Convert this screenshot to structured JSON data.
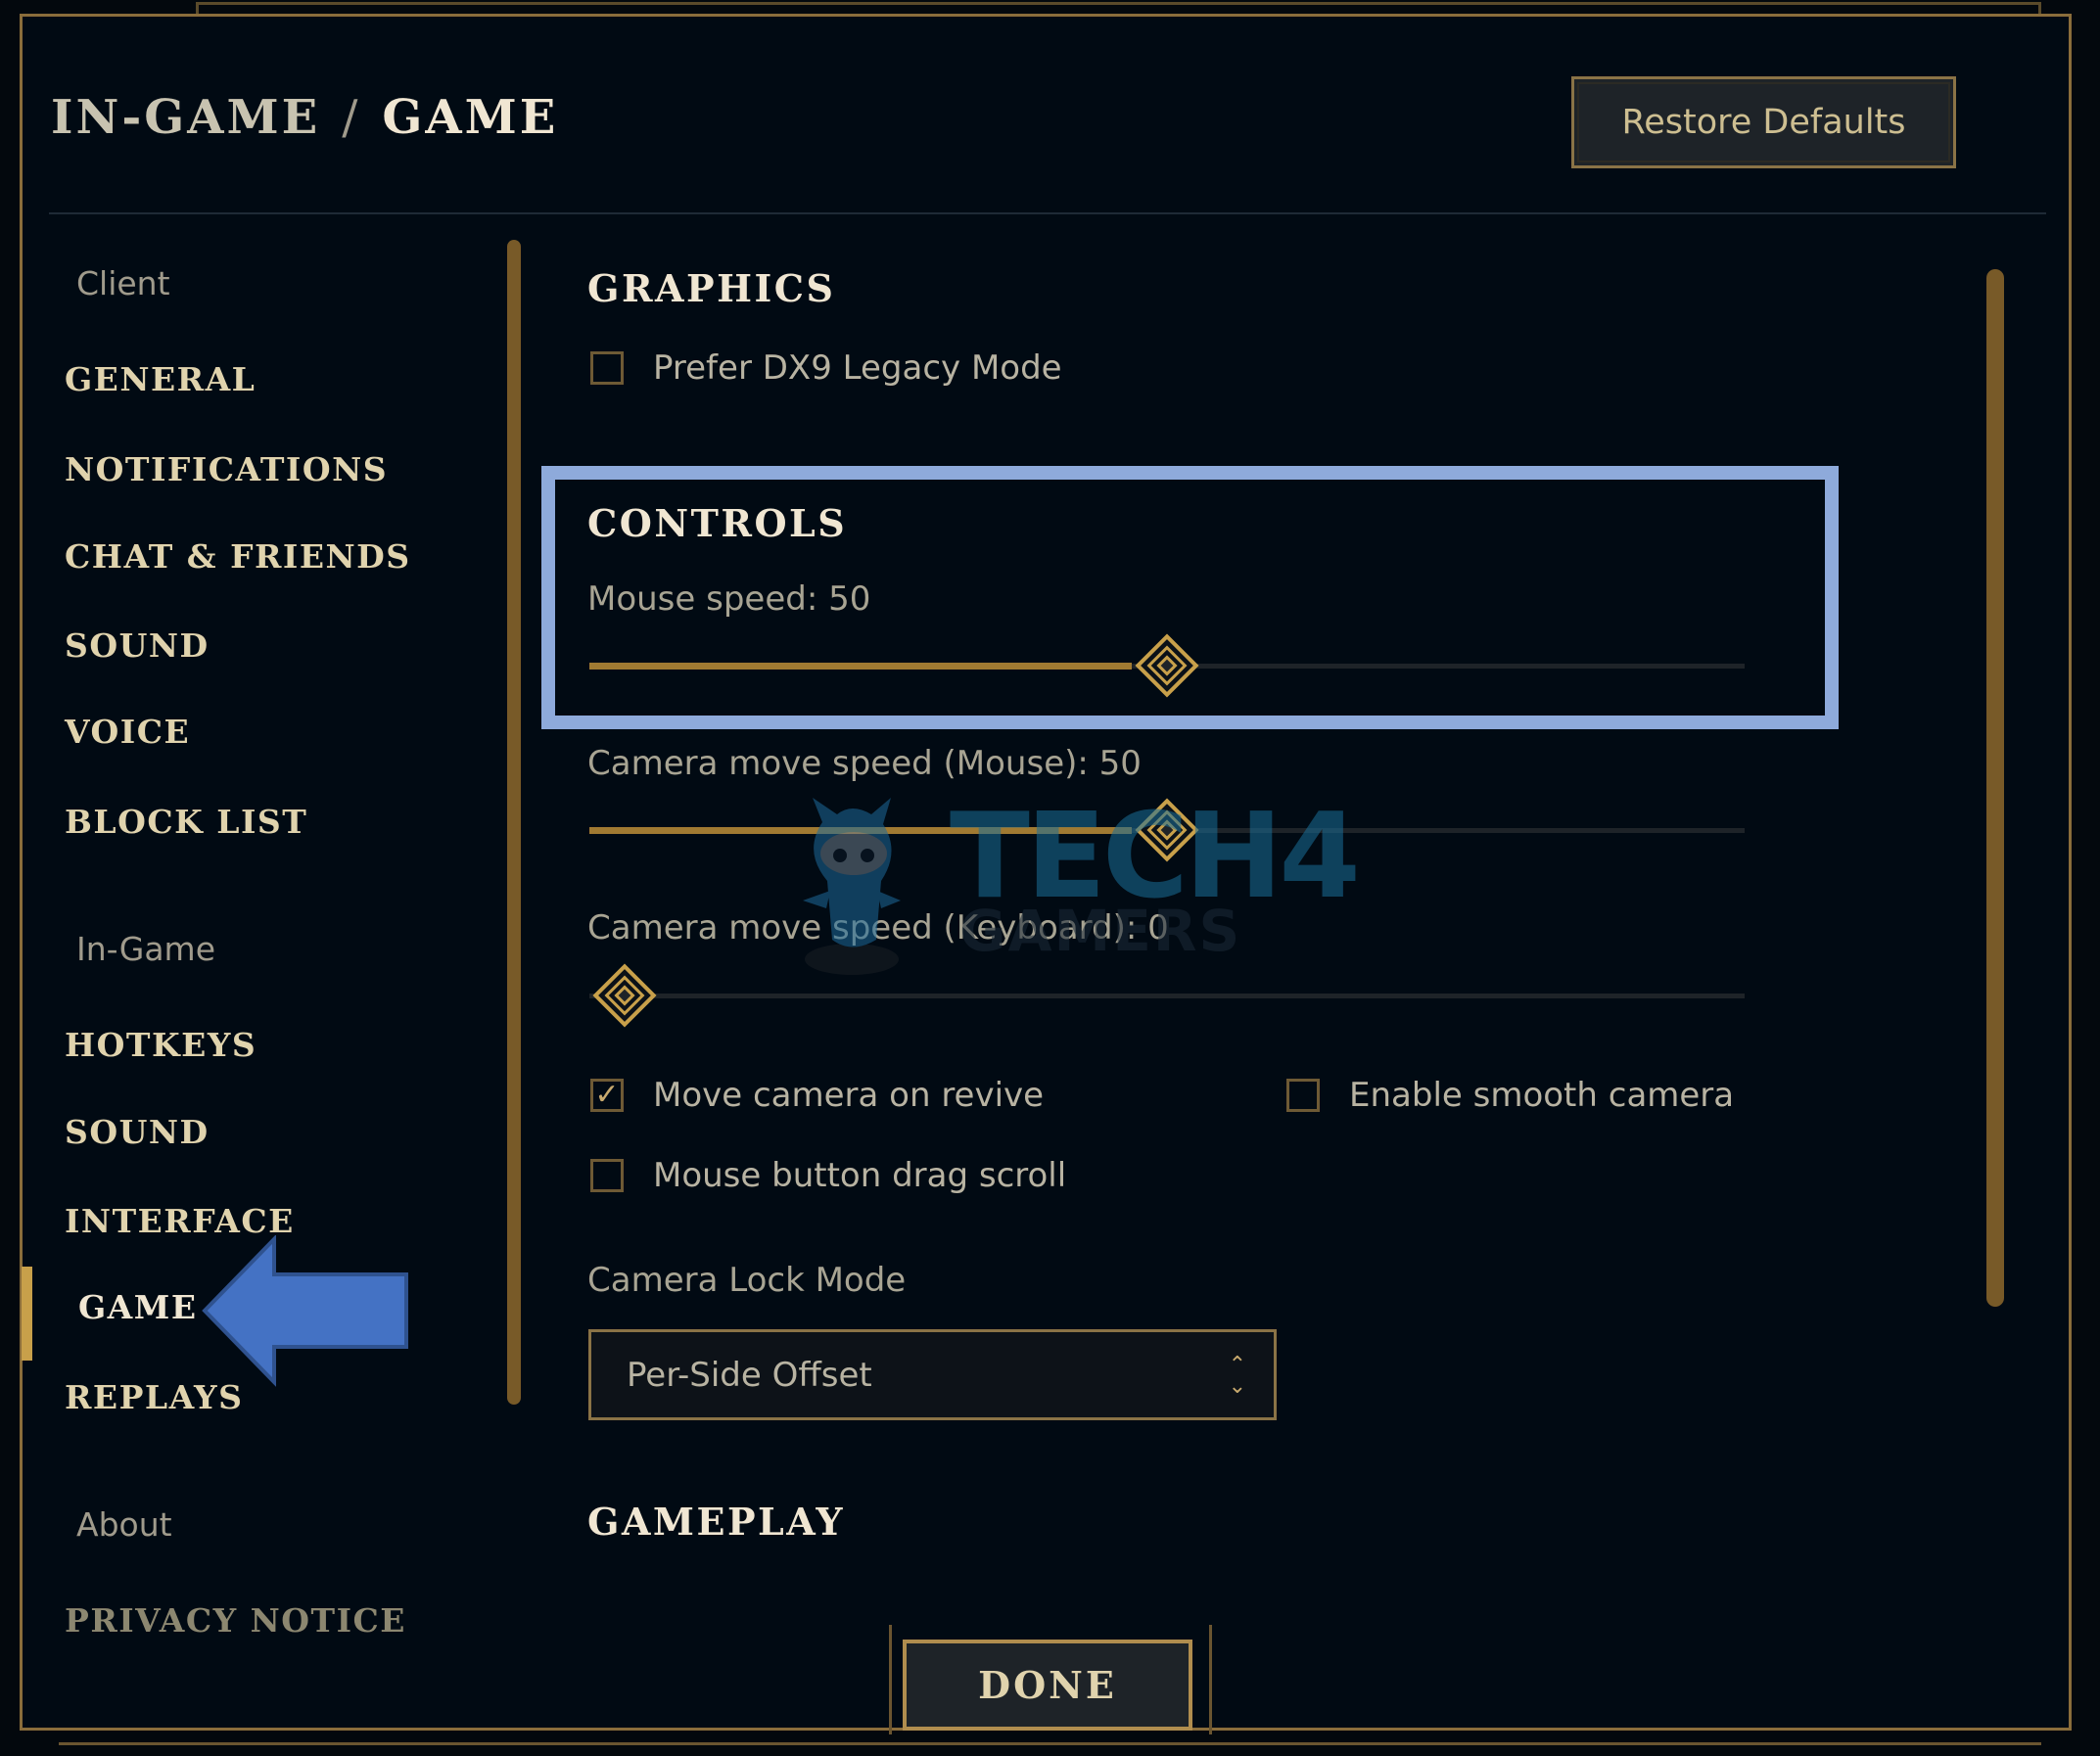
{
  "header": {
    "breadcrumb_parent": "IN-GAME",
    "breadcrumb_separator": "/",
    "breadcrumb_current": "GAME",
    "restore_defaults_label": "Restore Defaults"
  },
  "sidebar": {
    "groups": [
      {
        "label": "Client",
        "items": [
          "GENERAL",
          "NOTIFICATIONS",
          "CHAT & FRIENDS",
          "SOUND",
          "VOICE",
          "BLOCK LIST"
        ]
      },
      {
        "label": "In-Game",
        "items": [
          "HOTKEYS",
          "SOUND",
          "INTERFACE",
          "GAME",
          "REPLAYS"
        ]
      },
      {
        "label": "About",
        "items": [
          "PRIVACY NOTICE"
        ]
      }
    ],
    "active_item": "GAME"
  },
  "content": {
    "graphics": {
      "title": "GRAPHICS",
      "prefer_dx9": {
        "label": "Prefer DX9 Legacy Mode",
        "checked": false
      }
    },
    "controls": {
      "title": "CONTROLS",
      "mouse_speed": {
        "label": "Mouse speed: 50",
        "value": 50,
        "max": 100
      },
      "camera_mouse": {
        "label": "Camera move speed (Mouse): 50",
        "value": 50,
        "max": 100
      },
      "camera_keyboard": {
        "label": "Camera move speed (Keyboard): 0",
        "value": 0,
        "max": 100
      },
      "move_camera_revive": {
        "label": "Move camera on revive",
        "checked": true
      },
      "smooth_camera": {
        "label": "Enable smooth camera",
        "checked": false
      },
      "drag_scroll": {
        "label": "Mouse button drag scroll",
        "checked": false
      },
      "camera_lock_mode": {
        "label": "Camera Lock Mode",
        "selected": "Per-Side Offset"
      }
    },
    "gameplay": {
      "title": "GAMEPLAY"
    }
  },
  "footer": {
    "done_label": "DONE"
  },
  "annotations": {
    "highlight_color": "#8eaadb",
    "arrow_color": "#4472c4"
  },
  "watermark": {
    "line1": "TECH4",
    "line2": "GAMERS"
  },
  "colors": {
    "gold": "#c8aa6e",
    "gold_dark": "#785a28",
    "background": "#010a13",
    "text_title": "#f0e6d2"
  }
}
